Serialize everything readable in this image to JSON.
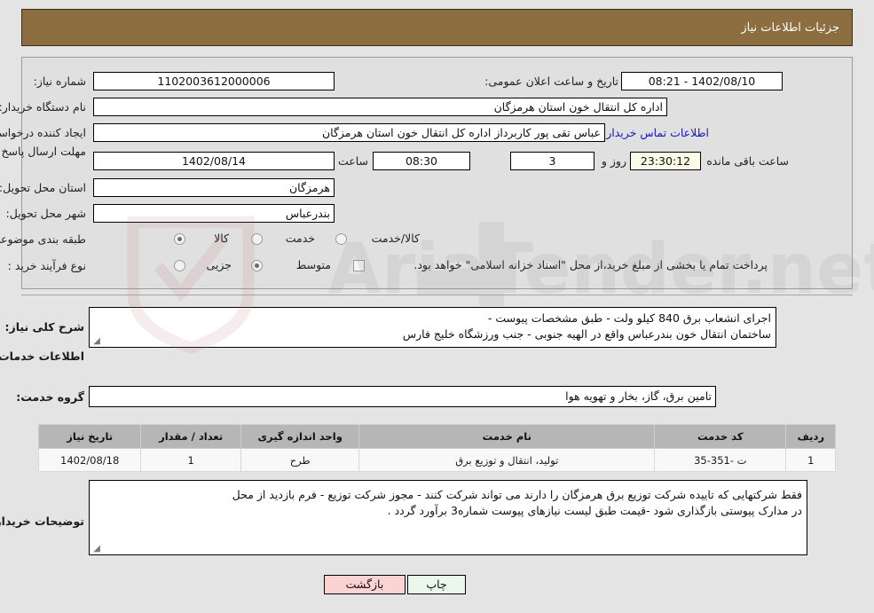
{
  "header": {
    "title": "جزئیات اطلاعات نیاز"
  },
  "form": {
    "need_number_label": "شماره نیاز:",
    "need_number_value": "1102003612000006",
    "announce_datetime_label": "تاریخ و ساعت اعلان عمومی:",
    "announce_datetime_value": "1402/08/10 - 08:21",
    "buyer_org_label": "نام دستگاه خریدار:",
    "buyer_org_value": "اداره کل انتقال خون استان هرمزگان",
    "requester_label": "ایجاد کننده درخواست:",
    "requester_value": "عباس تقی پور کاربرداز اداره کل انتقال خون استان هرمزگان",
    "buyer_contact_link": "اطلاعات تماس خریدار",
    "deadline_label": "مهلت ارسال پاسخ: تا تاریخ:",
    "deadline_date": "1402/08/14",
    "hour_label": "ساعت",
    "deadline_time": "08:30",
    "remaining_days": "3",
    "days_and_label": "روز و",
    "remaining_time": "23:30:12",
    "remaining_suffix_label": "ساعت باقی مانده",
    "province_label": "استان محل تحویل:",
    "province_value": "هرمزگان",
    "city_label": "شهر محل تحویل:",
    "city_value": "بندرعباس",
    "category_label": "طبقه بندی موضوعی:",
    "category_options": [
      {
        "label": "کالا",
        "selected": false
      },
      {
        "label": "خدمت",
        "selected": true
      },
      {
        "label": "کالا/خدمت",
        "selected": false
      }
    ],
    "process_type_label": "نوع فرآیند خرید :",
    "process_type_options": [
      {
        "label": "جزیی",
        "selected": false
      },
      {
        "label": "متوسط",
        "selected": true
      }
    ],
    "treasury_checkbox_checked": false,
    "treasury_note": "پرداخت تمام یا بخشی از مبلغ خرید،از محل \"اسناد خزانه اسلامی\" خواهد بود."
  },
  "description": {
    "label": "شرح کلی نیاز:",
    "lines": [
      "اجرای انشعاب برق 840 کیلو ولت - طبق مشخصات پیوست -",
      "ساختمان انتقال خون بندرعباس واقع در الهیه جنوبی - جنب ورزشگاه خلیج فارس"
    ]
  },
  "services_section": {
    "title": "اطلاعات خدمات مورد نیاز",
    "group_label": "گروه خدمت:",
    "group_value": "تامین برق، گاز، بخار و تهویه هوا"
  },
  "table": {
    "columns": [
      "ردیف",
      "کد خدمت",
      "نام خدمت",
      "واحد اندازه گیری",
      "تعداد / مقدار",
      "تاریخ نیاز"
    ],
    "rows": [
      [
        "1",
        "ت -351-35",
        "تولید، انتقال و توزیع برق",
        "طرح",
        "1",
        "1402/08/18"
      ]
    ]
  },
  "buyer_notes": {
    "label": "توضیحات خریدار:",
    "lines": [
      "فقط شرکتهایی که تاییده شرکت توزیع برق هرمزگان را دارند می تواند شرکت کنند - مجوز شرکت توزیع - فرم بازدید از محل",
      "در مدارک پیوستی بازگذاری شود -قیمت طبق لیست نیازهای پیوست شماره3 برآورد گردد ."
    ]
  },
  "footer": {
    "print_label": "چاپ",
    "back_label": "بازگشت"
  },
  "colors": {
    "header_brown": "#8d6e41",
    "link_blue": "#1a17c4",
    "table_header_gray": "#b6b6b6",
    "back_button_pink": "#fbd3d3",
    "print_button_green": "#eaf7ea",
    "countdown_ivory": "#fbfbe8"
  }
}
